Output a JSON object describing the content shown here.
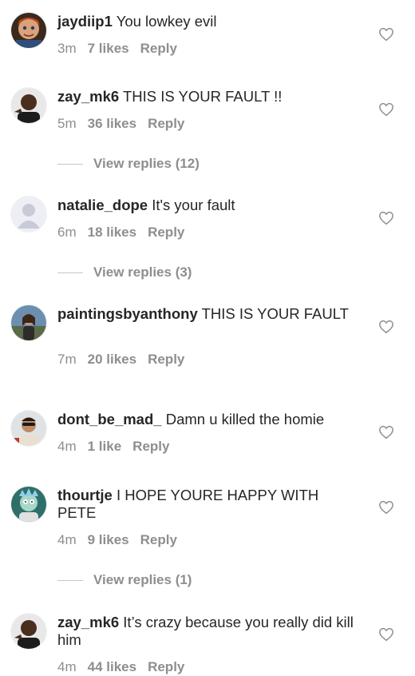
{
  "comments": [
    {
      "username": "jaydiip1",
      "text": "You lowkey evil",
      "time": "3m",
      "likes": "7 likes",
      "reply": "Reply",
      "avatar": "chucky-doll-avatar"
    },
    {
      "username": "zay_mk6",
      "text": "THIS IS YOUR FAULT !!",
      "time": "5m",
      "likes": "36 likes",
      "reply": "Reply",
      "avatar": "man-portrait-avatar",
      "view_replies": "View replies (12)"
    },
    {
      "username": "natalie_dope",
      "text": "It's your fault",
      "time": "6m",
      "likes": "18 likes",
      "reply": "Reply",
      "avatar": "default-profile-avatar",
      "view_replies": "View replies (3)"
    },
    {
      "username": "paintingsbyanthony",
      "text": "THIS IS YOUR FAULT",
      "time": "7m",
      "likes": "20 likes",
      "reply": "Reply",
      "avatar": "woman-portrait-avatar"
    },
    {
      "username": "dont_be_mad_",
      "text": "Damn u killed the homie",
      "time": "4m",
      "likes": "1 like",
      "reply": "Reply",
      "avatar": "man-sunglasses-avatar"
    },
    {
      "username": "thourtje",
      "text": "I HOPE YOURE HAPPY WITH PETE",
      "time": "4m",
      "likes": "9 likes",
      "reply": "Reply",
      "avatar": "cartoon-character-avatar",
      "view_replies": "View replies (1)"
    },
    {
      "username": "zay_mk6",
      "text": "It’s crazy because you really did kill him",
      "time": "4m",
      "likes": "44 likes",
      "reply": "Reply",
      "avatar": "man-portrait-avatar"
    }
  ],
  "icons": {
    "like": "heart-outline-icon"
  },
  "colors": {
    "text": "#262626",
    "muted": "#8e8e8e",
    "divider": "#c7c7c7"
  }
}
